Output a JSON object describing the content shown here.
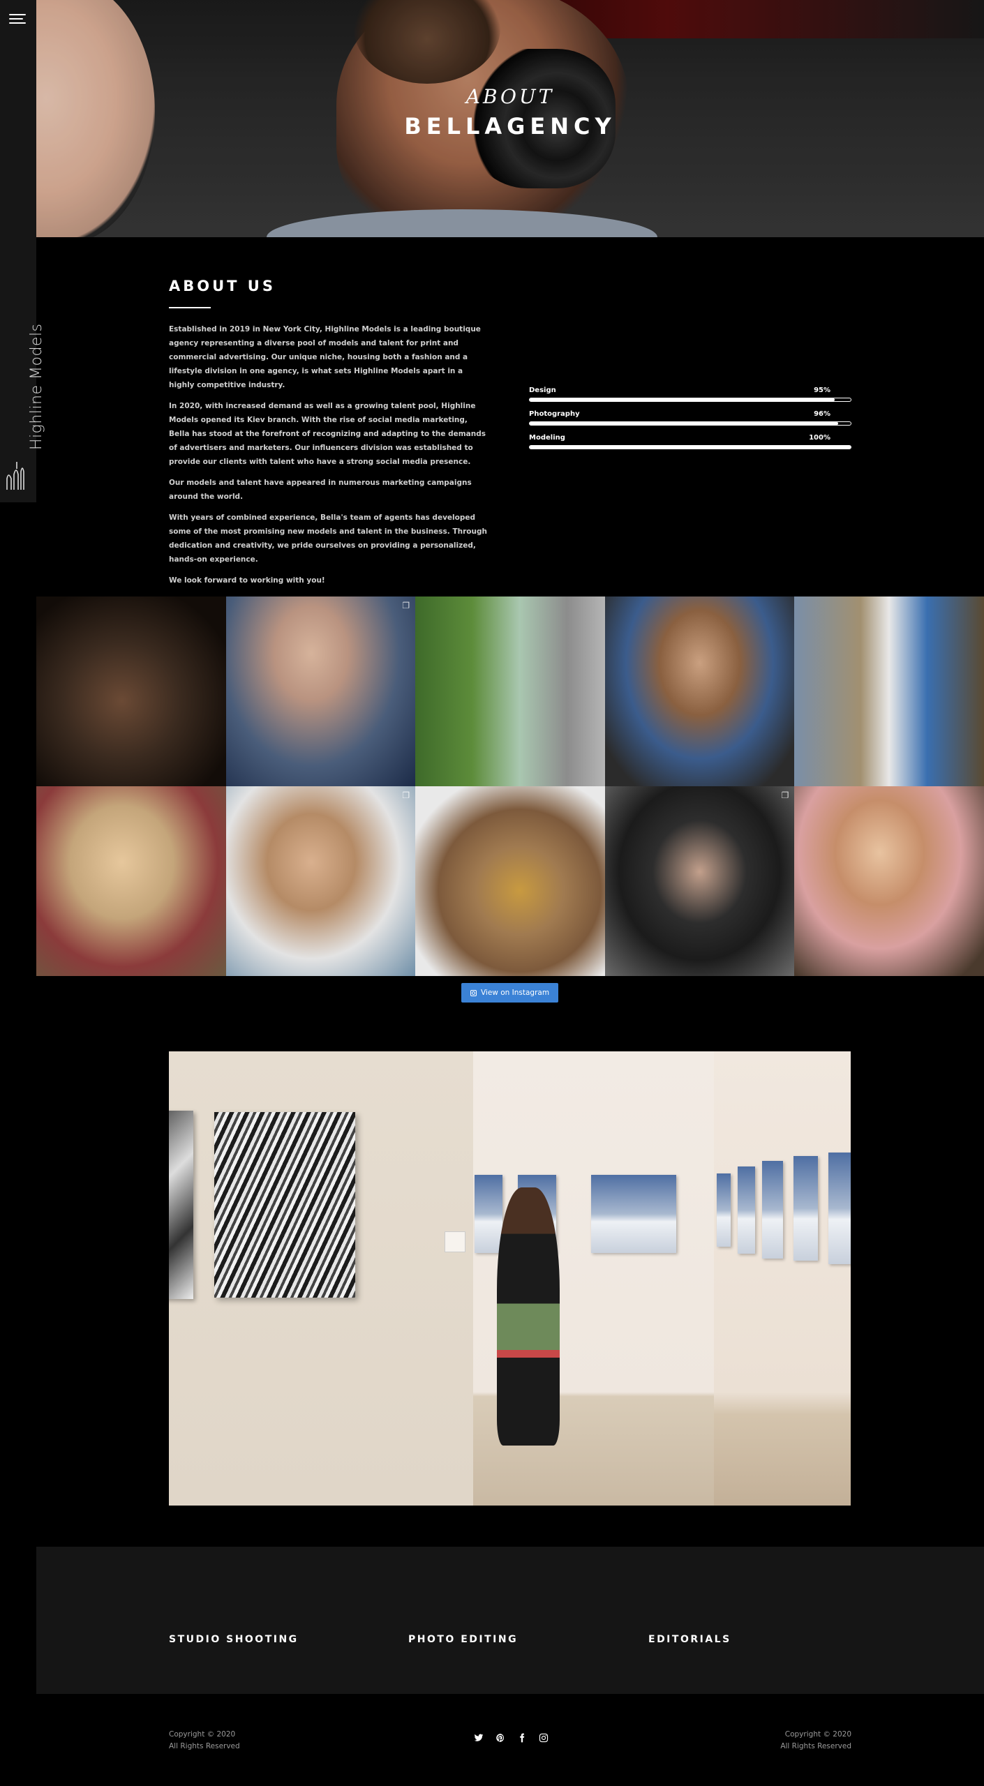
{
  "brand": {
    "side_text": "Highline Models"
  },
  "hero": {
    "subtitle": "ABOUT",
    "title": "BELLAGENCY"
  },
  "about": {
    "heading": "ABOUT US",
    "paragraphs": [
      "Established in 2019 in New York City, Highline Models is a leading boutique agency representing a diverse pool of models and talent for print and commercial advertising. Our unique niche, housing both a fashion and a lifestyle division in one agency, is what sets Highline Models apart in a highly competitive industry.",
      "In 2020, with increased demand as well as a growing talent pool, Highline Models opened its Kiev branch. With the rise of social media marketing, Bella has stood at the forefront of recognizing and adapting to the demands of advertisers and marketers. Our influencers division was established to provide our clients with talent who have a strong social media presence.",
      "Our models and talent have appeared in numerous marketing campaigns around the world.",
      "With years of combined experience, Bella's team of agents has developed some of the most promising new models and talent in the business. Through dedication and creativity, we pride ourselves on providing a personalized, hands-on experience.",
      "We look forward to working with you!"
    ]
  },
  "skills": [
    {
      "label": "Design",
      "percent_text": "95%",
      "value": 0.95
    },
    {
      "label": "Photography",
      "percent_text": "96%",
      "value": 0.96
    },
    {
      "label": "Modeling",
      "percent_text": "100%",
      "value": 1.0
    }
  ],
  "instagram": {
    "button_label": "View on Instagram",
    "tiles": 10
  },
  "services": {
    "items": [
      "STUDIO SHOOTING",
      "PHOTO EDITING",
      "EDITORIALS"
    ]
  },
  "footer": {
    "left": {
      "line1": "Copyright © 2020",
      "line2": "All Rights Reserved"
    },
    "right": {
      "line1": "Copyright © 2020",
      "line2": "All Rights Reserved"
    },
    "socials": [
      "twitter-icon",
      "pinterest-icon",
      "facebook-icon",
      "instagram-icon"
    ]
  }
}
